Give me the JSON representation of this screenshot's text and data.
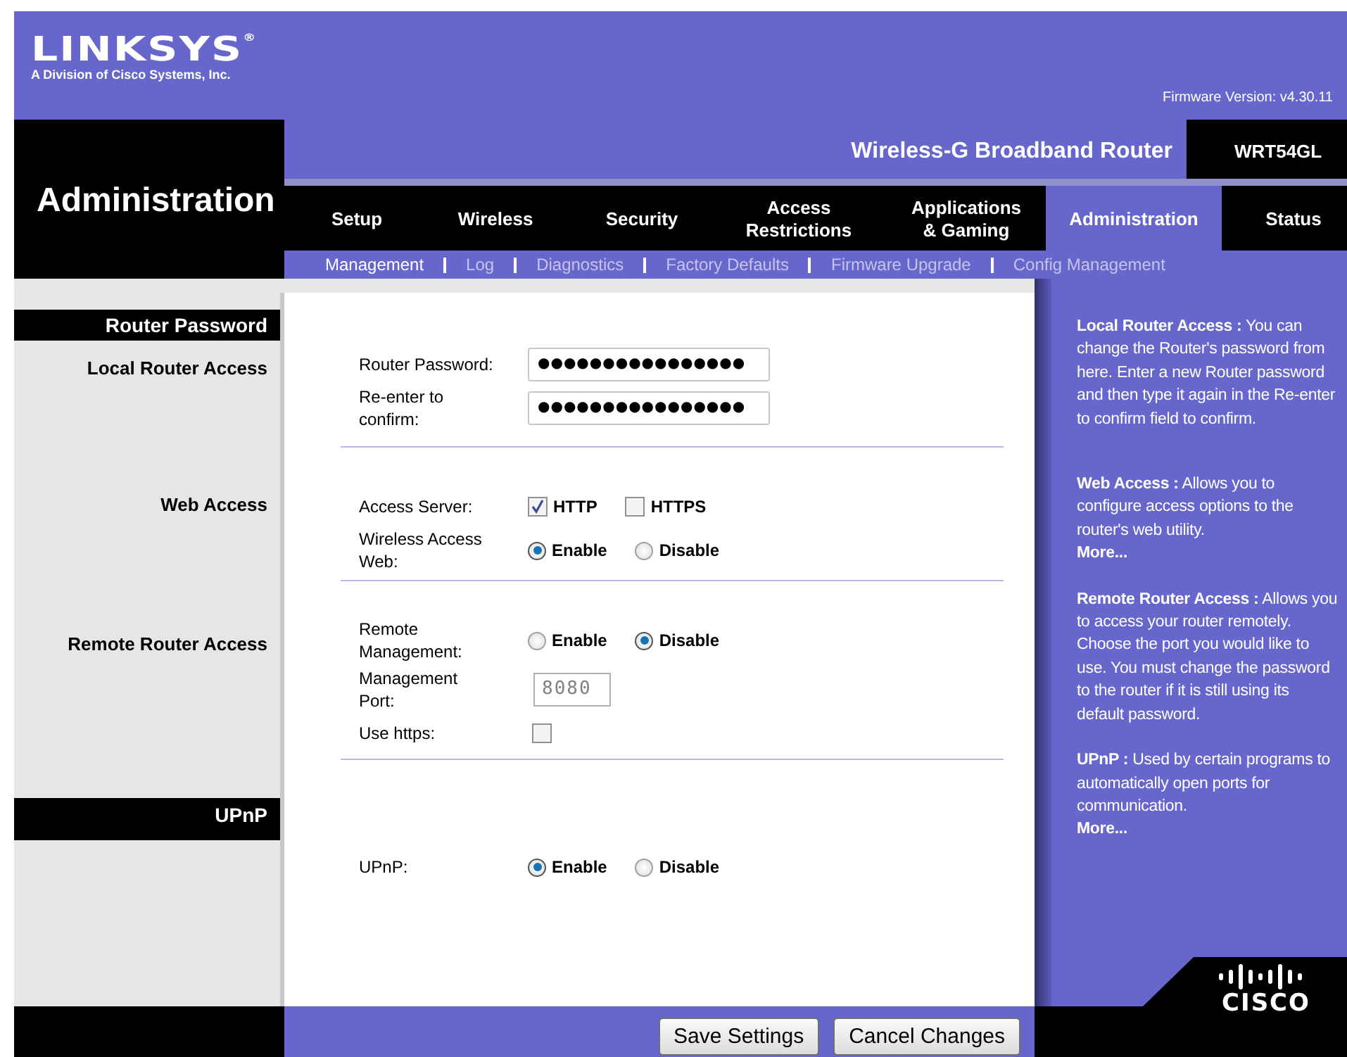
{
  "brand": {
    "logo": "LINKSYS$^{®}$",
    "tagline": "A Division of Cisco Systems, Inc.",
    "firmware": "Firmware Version: v4.30.11"
  },
  "product": {
    "name": "Wireless-G Broadband Router",
    "model": "WRT54GL"
  },
  "page_title": "Administration",
  "tabs": [
    {
      "label": "Setup",
      "selected": false
    },
    {
      "label": "Wireless",
      "selected": false
    },
    {
      "label": "Security",
      "selected": false
    },
    {
      "label": "Access Restrictions",
      "selected": false
    },
    {
      "label": "Applications & Gaming",
      "selected": false
    },
    {
      "label": "Administration",
      "selected": true
    },
    {
      "label": "Status",
      "selected": false
    }
  ],
  "subtabs": [
    {
      "label": "Management",
      "selected": true
    },
    {
      "label": "Log",
      "selected": false
    },
    {
      "label": "Diagnostics",
      "selected": false
    },
    {
      "label": "Factory Defaults",
      "selected": false
    },
    {
      "label": "Firmware Upgrade",
      "selected": false
    },
    {
      "label": "Config Management",
      "selected": false
    }
  ],
  "sections": [
    {
      "header": "Router Password",
      "label": "Local Router Access",
      "rows": [
        {
          "kind": "password",
          "label": "Router Password:",
          "value": "●●●●●●●●●●●●●●●●"
        },
        {
          "kind": "password",
          "label": "Re-enter to confirm:",
          "value": "●●●●●●●●●●●●●●●●"
        }
      ]
    },
    {
      "label": "Web Access",
      "rows": [
        {
          "kind": "checks",
          "label": "Access Server:",
          "options": [
            {
              "label": "HTTP",
              "checked": true
            },
            {
              "label": "HTTPS",
              "checked": false
            }
          ]
        },
        {
          "kind": "radios",
          "label": "Wireless Access Web:",
          "options": [
            {
              "label": "Enable",
              "selected": true
            },
            {
              "label": "Disable",
              "selected": false
            }
          ]
        }
      ]
    },
    {
      "label": "Remote Router Access",
      "rows": [
        {
          "kind": "radios",
          "label": "Remote Management:",
          "options": [
            {
              "label": "Enable",
              "selected": false
            },
            {
              "label": "Disable",
              "selected": true
            }
          ]
        },
        {
          "kind": "text",
          "label": "Management Port:",
          "value": "8080",
          "disabled": true
        },
        {
          "kind": "checkbox",
          "label": "Use https:",
          "checked": false
        }
      ]
    },
    {
      "header": "UPnP",
      "rows": [
        {
          "kind": "radios",
          "label": "UPnP:",
          "options": [
            {
              "label": "Enable",
              "selected": true
            },
            {
              "label": "Disable",
              "selected": false
            }
          ]
        }
      ]
    }
  ],
  "help": [
    {
      "text": "**Local Router Access :** You can change the Router's password from here. Enter a new Router password and then type it again in the Re-enter to confirm field to confirm."
    },
    {
      "text": "**Web Access :** Allows you to configure access options to the router's web utility.",
      "more": "More..."
    },
    {
      "text": "**Remote Router Access :** Allows you to access your router remotely. Choose the port you would like to use. You must change the password to the router if it is still using its default password."
    },
    {
      "text": "**UPnP :** Used by certain programs to automatically open ports for communication.",
      "more": "More..."
    }
  ],
  "buttons": [
    "Save Settings",
    "Cancel Changes"
  ],
  "footer_logo": "CISCO"
}
